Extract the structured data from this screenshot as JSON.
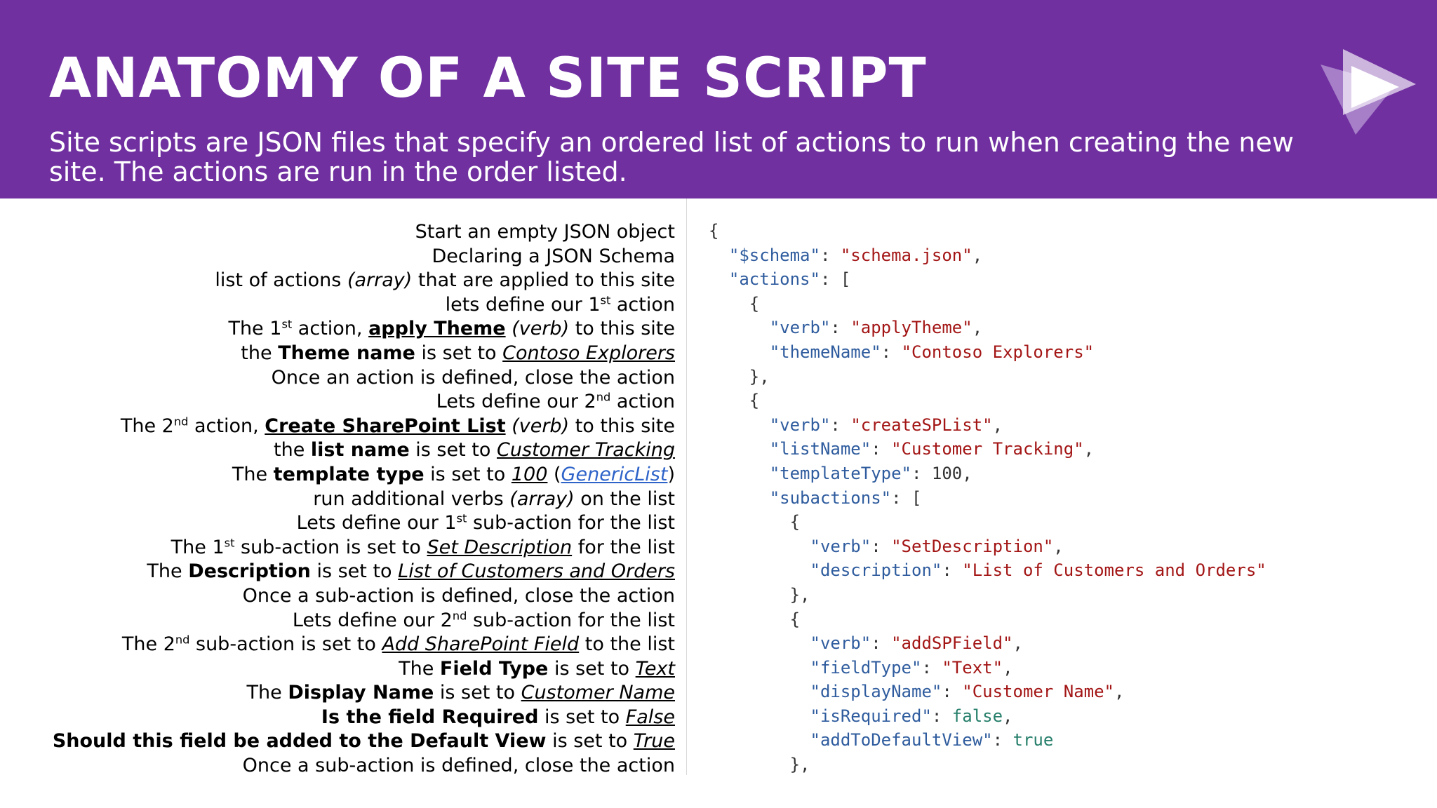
{
  "slide": {
    "title": "ANATOMY OF A SITE SCRIPT",
    "subtitle": "Site scripts are JSON files that specify an ordered list of actions to run when creating the new\nsite. The actions are run in the order listed."
  },
  "colors": {
    "header": "#7030a0",
    "key": "#2f5c9e",
    "string": "#a31515",
    "literal": "#267f6b",
    "link": "#2e63c9"
  },
  "logo": {
    "icon": "play-triangle-icon"
  },
  "explanations": [
    [
      {
        "t": "Start an empty JSON object"
      }
    ],
    [
      {
        "t": "Declaring a JSON Schema"
      }
    ],
    [
      {
        "t": "list of actions "
      },
      {
        "t": "(array)",
        "s": "i"
      },
      {
        "t": " that are applied to this site"
      }
    ],
    [
      {
        "t": "lets define our 1"
      },
      {
        "t": "st",
        "s": "sup"
      },
      {
        "t": " action"
      }
    ],
    [
      {
        "t": "The 1"
      },
      {
        "t": "st",
        "s": "sup"
      },
      {
        "t": " action, "
      },
      {
        "t": "apply Theme",
        "s": "bu"
      },
      {
        "t": " "
      },
      {
        "t": "(verb)",
        "s": "i"
      },
      {
        "t": " to this site"
      }
    ],
    [
      {
        "t": "the "
      },
      {
        "t": "Theme name",
        "s": "b"
      },
      {
        "t": " is set to "
      },
      {
        "t": "Contoso Explorers",
        "s": "iu"
      }
    ],
    [
      {
        "t": "Once an action is defined, close the action"
      }
    ],
    [
      {
        "t": "Lets define our 2"
      },
      {
        "t": "nd",
        "s": "sup"
      },
      {
        "t": " action"
      }
    ],
    [
      {
        "t": "The 2"
      },
      {
        "t": "nd",
        "s": "sup"
      },
      {
        "t": " action, "
      },
      {
        "t": "Create SharePoint List",
        "s": "bu"
      },
      {
        "t": " "
      },
      {
        "t": "(verb)",
        "s": "i"
      },
      {
        "t": " to this site"
      }
    ],
    [
      {
        "t": "the "
      },
      {
        "t": "list name",
        "s": "b"
      },
      {
        "t": " is set to "
      },
      {
        "t": "Customer Tracking",
        "s": "iu"
      }
    ],
    [
      {
        "t": "The "
      },
      {
        "t": "template type",
        "s": "b"
      },
      {
        "t": " is set to "
      },
      {
        "t": "100",
        "s": "iu"
      },
      {
        "t": " ("
      },
      {
        "t": "GenericList",
        "s": "link"
      },
      {
        "t": ")"
      }
    ],
    [
      {
        "t": "run additional verbs "
      },
      {
        "t": "(array)",
        "s": "i"
      },
      {
        "t": " on the list"
      }
    ],
    [
      {
        "t": "Lets define our 1"
      },
      {
        "t": "st",
        "s": "sup"
      },
      {
        "t": " sub-action for the list"
      }
    ],
    [
      {
        "t": "The 1"
      },
      {
        "t": "st",
        "s": "sup"
      },
      {
        "t": " sub-action is set to "
      },
      {
        "t": "Set Description",
        "s": "iu"
      },
      {
        "t": " for the list"
      }
    ],
    [
      {
        "t": "The "
      },
      {
        "t": "Description",
        "s": "b"
      },
      {
        "t": " is set to "
      },
      {
        "t": "List of Customers and Orders",
        "s": "iu"
      }
    ],
    [
      {
        "t": "Once a sub-action is defined, close the action"
      }
    ],
    [
      {
        "t": "Lets define our 2"
      },
      {
        "t": "nd",
        "s": "sup"
      },
      {
        "t": " sub-action for the list"
      }
    ],
    [
      {
        "t": "The 2"
      },
      {
        "t": "nd",
        "s": "sup"
      },
      {
        "t": " sub-action is set to "
      },
      {
        "t": "Add SharePoint Field",
        "s": "iu"
      },
      {
        "t": " to the list"
      }
    ],
    [
      {
        "t": "The "
      },
      {
        "t": "Field Type",
        "s": "b"
      },
      {
        "t": " is set to "
      },
      {
        "t": "Text",
        "s": "iu"
      }
    ],
    [
      {
        "t": "The "
      },
      {
        "t": "Display Name",
        "s": "b"
      },
      {
        "t": " is set to "
      },
      {
        "t": "Customer Name",
        "s": "iu"
      }
    ],
    [
      {
        "t": "Is the field Required",
        "s": "b"
      },
      {
        "t": " is set to "
      },
      {
        "t": "False",
        "s": "iu"
      }
    ],
    [
      {
        "t": "Should this field be added to the Default View",
        "s": "b"
      },
      {
        "t": " is set to "
      },
      {
        "t": "True",
        "s": "iu"
      }
    ],
    [
      {
        "t": "Once a sub-action is defined, close the action"
      }
    ]
  ],
  "code_lines": [
    [
      {
        "t": "{",
        "c": "p"
      }
    ],
    [
      {
        "t": "  "
      },
      {
        "t": "\"$schema\"",
        "c": "k"
      },
      {
        "t": ": ",
        "c": "p"
      },
      {
        "t": "\"schema.json\"",
        "c": "s"
      },
      {
        "t": ",",
        "c": "p"
      }
    ],
    [
      {
        "t": "  "
      },
      {
        "t": "\"actions\"",
        "c": "k"
      },
      {
        "t": ": [",
        "c": "p"
      }
    ],
    [
      {
        "t": "    "
      },
      {
        "t": "{",
        "c": "p"
      }
    ],
    [
      {
        "t": "      "
      },
      {
        "t": "\"verb\"",
        "c": "k"
      },
      {
        "t": ": ",
        "c": "p"
      },
      {
        "t": "\"applyTheme\"",
        "c": "s"
      },
      {
        "t": ",",
        "c": "p"
      }
    ],
    [
      {
        "t": "      "
      },
      {
        "t": "\"themeName\"",
        "c": "k"
      },
      {
        "t": ": ",
        "c": "p"
      },
      {
        "t": "\"Contoso Explorers\"",
        "c": "s"
      }
    ],
    [
      {
        "t": "    "
      },
      {
        "t": "},",
        "c": "p"
      }
    ],
    [
      {
        "t": "    "
      },
      {
        "t": "{",
        "c": "p"
      }
    ],
    [
      {
        "t": "      "
      },
      {
        "t": "\"verb\"",
        "c": "k"
      },
      {
        "t": ": ",
        "c": "p"
      },
      {
        "t": "\"createSPList\"",
        "c": "s"
      },
      {
        "t": ",",
        "c": "p"
      }
    ],
    [
      {
        "t": "      "
      },
      {
        "t": "\"listName\"",
        "c": "k"
      },
      {
        "t": ": ",
        "c": "p"
      },
      {
        "t": "\"Customer Tracking\"",
        "c": "s"
      },
      {
        "t": ",",
        "c": "p"
      }
    ],
    [
      {
        "t": "      "
      },
      {
        "t": "\"templateType\"",
        "c": "k"
      },
      {
        "t": ": ",
        "c": "p"
      },
      {
        "t": "100",
        "c": "p"
      },
      {
        "t": ",",
        "c": "p"
      }
    ],
    [
      {
        "t": "      "
      },
      {
        "t": "\"subactions\"",
        "c": "k"
      },
      {
        "t": ": [",
        "c": "p"
      }
    ],
    [
      {
        "t": "        "
      },
      {
        "t": "{",
        "c": "p"
      }
    ],
    [
      {
        "t": "          "
      },
      {
        "t": "\"verb\"",
        "c": "k"
      },
      {
        "t": ": ",
        "c": "p"
      },
      {
        "t": "\"SetDescription\"",
        "c": "s"
      },
      {
        "t": ",",
        "c": "p"
      }
    ],
    [
      {
        "t": "          "
      },
      {
        "t": "\"description\"",
        "c": "k"
      },
      {
        "t": ": ",
        "c": "p"
      },
      {
        "t": "\"List of Customers and Orders\"",
        "c": "s"
      }
    ],
    [
      {
        "t": "        "
      },
      {
        "t": "},",
        "c": "p"
      }
    ],
    [
      {
        "t": "        "
      },
      {
        "t": "{",
        "c": "p"
      }
    ],
    [
      {
        "t": "          "
      },
      {
        "t": "\"verb\"",
        "c": "k"
      },
      {
        "t": ": ",
        "c": "p"
      },
      {
        "t": "\"addSPField\"",
        "c": "s"
      },
      {
        "t": ",",
        "c": "p"
      }
    ],
    [
      {
        "t": "          "
      },
      {
        "t": "\"fieldType\"",
        "c": "k"
      },
      {
        "t": ": ",
        "c": "p"
      },
      {
        "t": "\"Text\"",
        "c": "s"
      },
      {
        "t": ",",
        "c": "p"
      }
    ],
    [
      {
        "t": "          "
      },
      {
        "t": "\"displayName\"",
        "c": "k"
      },
      {
        "t": ": ",
        "c": "p"
      },
      {
        "t": "\"Customer Name\"",
        "c": "s"
      },
      {
        "t": ",",
        "c": "p"
      }
    ],
    [
      {
        "t": "          "
      },
      {
        "t": "\"isRequired\"",
        "c": "k"
      },
      {
        "t": ": ",
        "c": "p"
      },
      {
        "t": "false",
        "c": "n"
      },
      {
        "t": ",",
        "c": "p"
      }
    ],
    [
      {
        "t": "          "
      },
      {
        "t": "\"addToDefaultView\"",
        "c": "k"
      },
      {
        "t": ": ",
        "c": "p"
      },
      {
        "t": "true",
        "c": "n"
      }
    ],
    [
      {
        "t": "        "
      },
      {
        "t": "},",
        "c": "p"
      }
    ]
  ]
}
